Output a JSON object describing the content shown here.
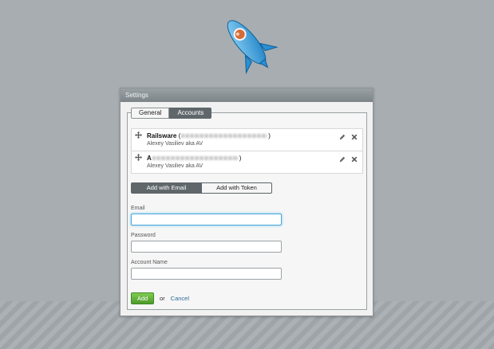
{
  "settings": {
    "title": "Settings",
    "tabs": [
      {
        "label": "General",
        "active": false
      },
      {
        "label": "Accounts",
        "active": true
      }
    ],
    "accounts": [
      {
        "name": "Railsware",
        "email_open": "(",
        "email_close": ")",
        "subtitle": "Alexey Vasiliev aka AV"
      },
      {
        "name": "A",
        "email_open": "",
        "email_close": ")",
        "subtitle": "Alexey Vasiliev aka AV"
      }
    ],
    "auth_toggle": {
      "email_label": "Add with Email",
      "token_label": "Add with Token",
      "selected": "email"
    },
    "form": {
      "email_label": "Email",
      "email_value": "",
      "password_label": "Password",
      "password_value": "",
      "account_name_label": "Account Name",
      "account_name_value": ""
    },
    "actions": {
      "add_label": "Add",
      "or_label": "or",
      "cancel_label": "Cancel"
    }
  },
  "colors": {
    "background": "#a7adb1",
    "header": "#8a9195",
    "active_tab": "#60676b",
    "add_button": "#5fae3a",
    "link": "#2b6d99",
    "focus": "#4aa8d8"
  },
  "icons": [
    "rocket-logo-icon",
    "drag-handle-icon",
    "pencil-icon",
    "close-icon"
  ]
}
